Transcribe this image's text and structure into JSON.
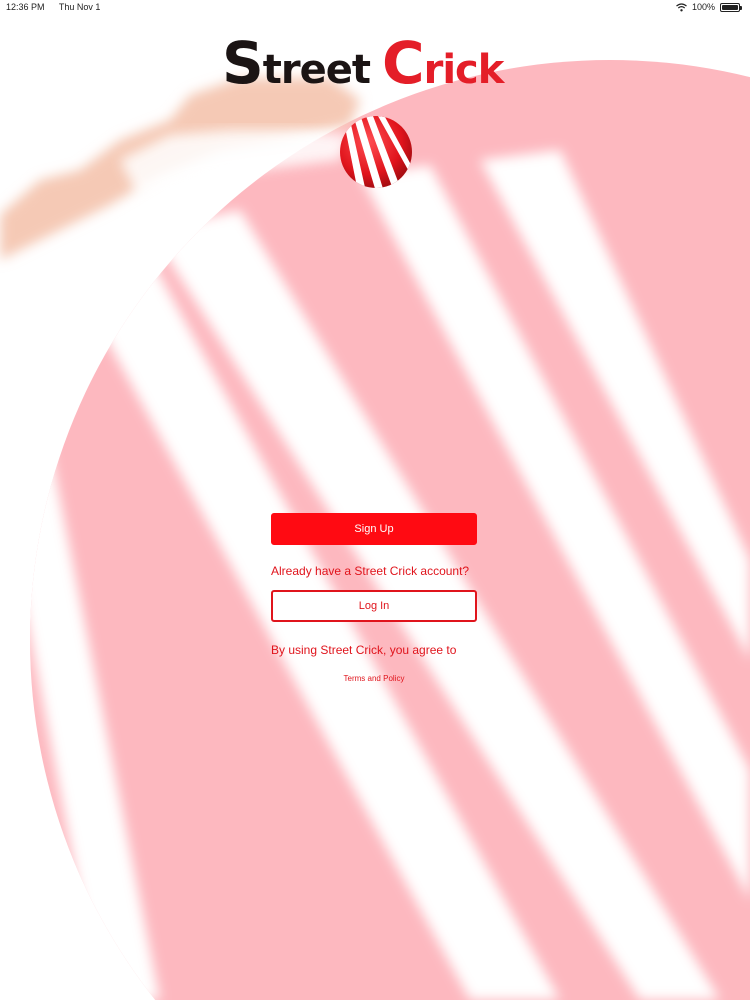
{
  "status_bar": {
    "time": "12:36 PM",
    "date": "Thu Nov 1",
    "battery": "100%",
    "battery_level": 1.0,
    "icons": [
      "wifi-icon",
      "battery-icon"
    ]
  },
  "brand": {
    "word1_cap": "S",
    "word1_rest": "treet",
    "word2_cap": "C",
    "word2_rest": "rick",
    "colors": {
      "dark": "#1b1414",
      "red": "#e41e28"
    }
  },
  "actions": {
    "signup_label": "Sign Up",
    "account_prompt": "Already have a Street Crick account?",
    "login_label": "Log In",
    "agree_text": "By using Street Crick, you agree to",
    "terms_label": "Terms and Policy"
  },
  "theme": {
    "accent": "#ff0a12",
    "background_ball": "#fdb8bf",
    "background_white": "#ffffff",
    "skin": "#f5c9b5"
  }
}
